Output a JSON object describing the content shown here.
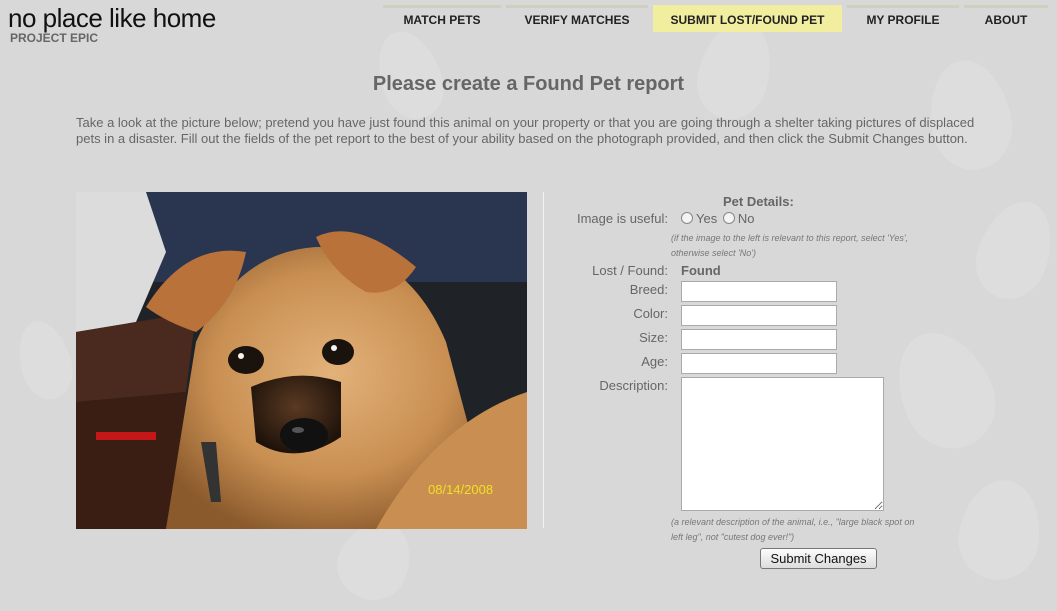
{
  "logo": {
    "title": "no place like home",
    "subtitle": "PROJECT EPIC"
  },
  "nav": {
    "items": [
      {
        "label": "MATCH PETS"
      },
      {
        "label": "VERIFY MATCHES"
      },
      {
        "label": "SUBMIT LOST/FOUND PET",
        "active": true
      },
      {
        "label": "MY PROFILE"
      },
      {
        "label": "ABOUT"
      }
    ],
    "active_color": "#f2eea0"
  },
  "page": {
    "heading": "Please create a Found Pet report",
    "intro": "Take a look at the picture below; pretend you have just found this animal on your property or that you are going through a shelter taking pictures of displaced pets in a disaster. Fill out the fields of the pet report to the best of your ability based on the photograph provided, and then click the Submit Changes button."
  },
  "photo": {
    "date_stamp": "08/14/2008"
  },
  "form": {
    "heading": "Pet Details:",
    "image_useful": {
      "label": "Image is useful:",
      "options": [
        "Yes",
        "No"
      ],
      "note_line1": "(if the image to the left is relevant to this report, select 'Yes',",
      "note_line2": "otherwise select 'No')"
    },
    "lost_found": {
      "label": "Lost / Found:",
      "value": "Found"
    },
    "breed": {
      "label": "Breed:",
      "value": ""
    },
    "color": {
      "label": "Color:",
      "value": ""
    },
    "size": {
      "label": "Size:",
      "value": ""
    },
    "age": {
      "label": "Age:",
      "value": ""
    },
    "description": {
      "label": "Description:",
      "value": "",
      "note_line1": "(a relevant description of the animal, i.e., \"large black spot on",
      "note_line2": "left leg\", not \"cutest dog ever!\")"
    },
    "submit_label": "Submit Changes"
  }
}
